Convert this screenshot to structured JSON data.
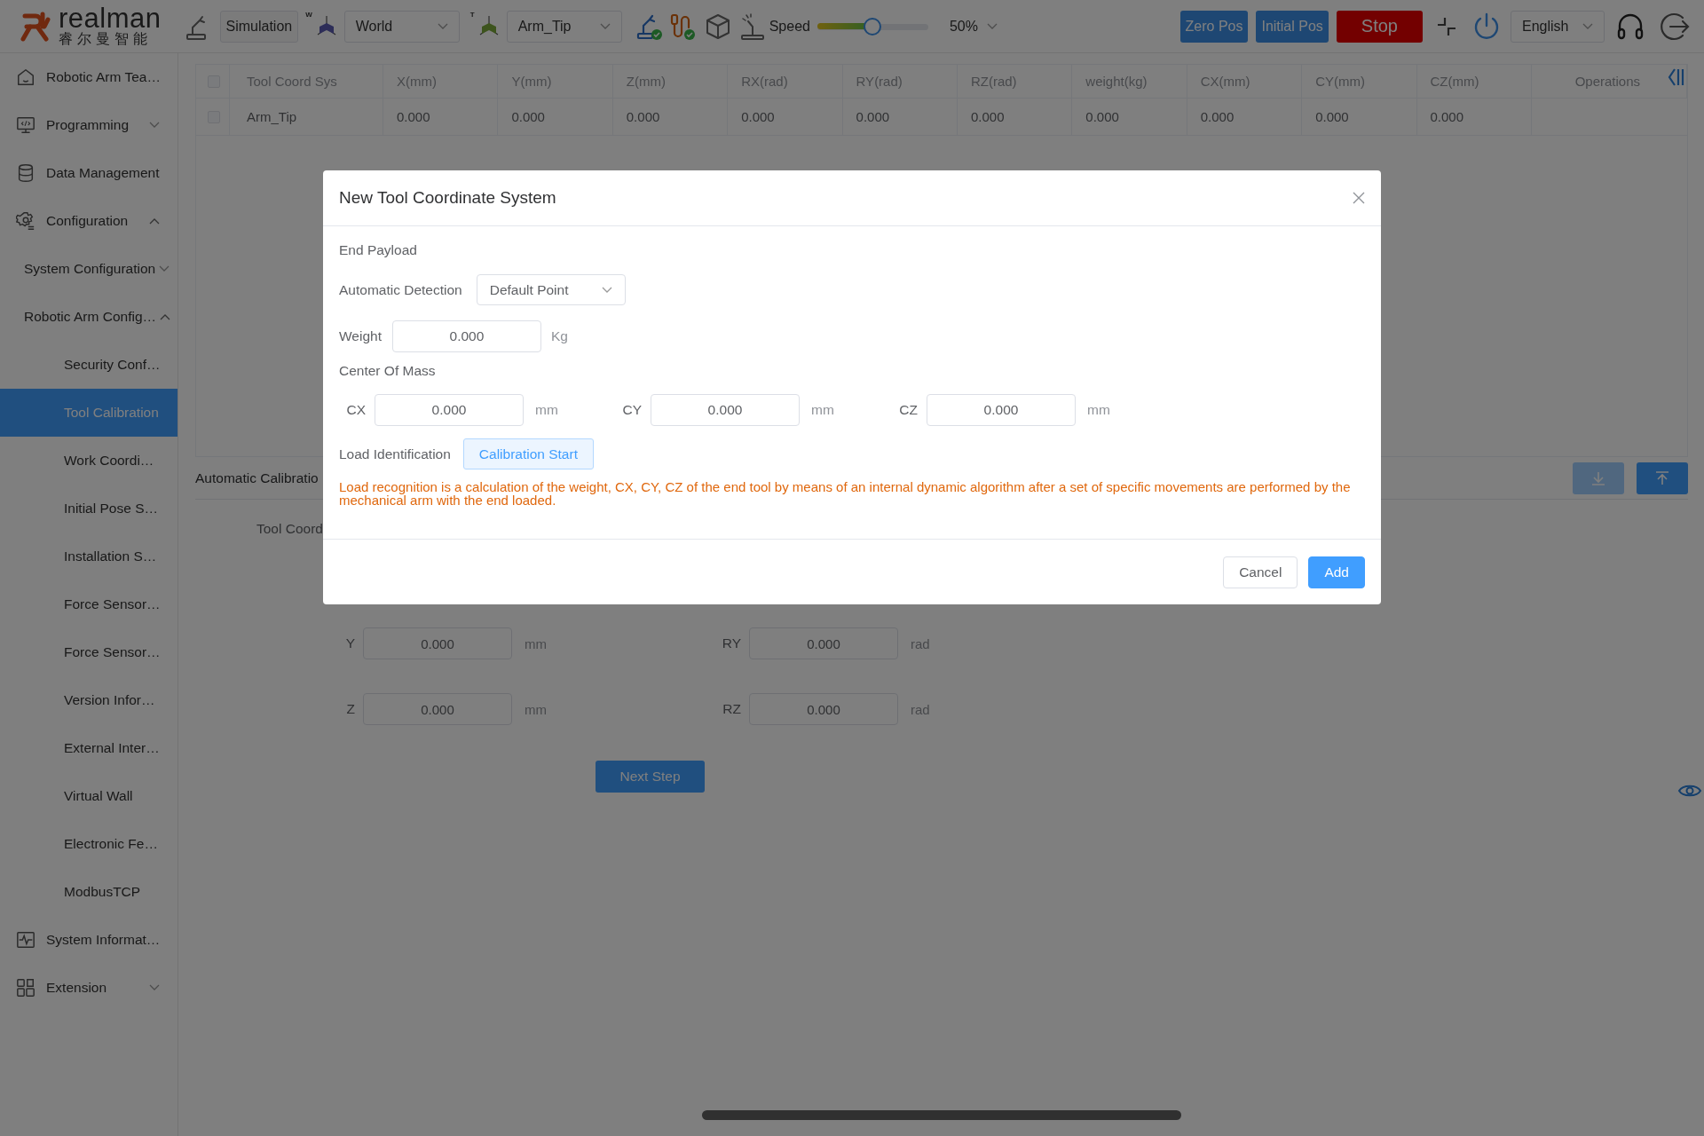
{
  "top_bar": {
    "logo": {
      "brand": "realman",
      "subtitle": "睿尔曼智能"
    },
    "mode_button": "Simulation",
    "coord_axis_letter": "W",
    "coord_select": "World",
    "tool_axis_letter": "T",
    "tool_select": "Arm_Tip",
    "speed": {
      "label": "Speed",
      "level": 0.5,
      "reading": "50%"
    },
    "buttons": [
      {
        "label": "Zero Pos",
        "kind": "primary"
      },
      {
        "label": "Initial Pos",
        "kind": "primary"
      },
      {
        "label": "Stop",
        "kind": "danger"
      }
    ],
    "language": "English"
  },
  "sidebar": {
    "items": [
      {
        "label": "Robotic Arm Tea…",
        "selected": false
      },
      {
        "label": "Programming",
        "selected": false,
        "expanded": false
      },
      {
        "label": "Data Management",
        "selected": false
      },
      {
        "label": "Configuration",
        "selected": false,
        "expanded": true,
        "children": [
          {
            "label": "System Configuration",
            "selected": false,
            "expanded": false
          },
          {
            "label": "Robotic Arm Config…",
            "selected": false,
            "expanded": true,
            "children": [
              {
                "label": "Security Conf…",
                "selected": false
              },
              {
                "label": "Tool Calibration",
                "selected": true
              },
              {
                "label": "Work Coordi…",
                "selected": false
              },
              {
                "label": "Initial Pose S…",
                "selected": false
              },
              {
                "label": "Installation S…",
                "selected": false
              },
              {
                "label": "Force Sensor…",
                "selected": false
              },
              {
                "label": "Force Sensor…",
                "selected": false
              },
              {
                "label": "Version Infor…",
                "selected": false
              },
              {
                "label": "External Inter…",
                "selected": false
              },
              {
                "label": "Virtual Wall",
                "selected": false
              },
              {
                "label": "Electronic Fe…",
                "selected": false
              },
              {
                "label": "ModbusTCP",
                "selected": false
              }
            ]
          }
        ]
      },
      {
        "label": "System Informat…",
        "selected": false
      },
      {
        "label": "Extension",
        "selected": false,
        "expanded": false
      }
    ]
  },
  "table": {
    "select_all": false,
    "columns": [
      "Tool Coord Sys",
      "X(mm)",
      "Y(mm)",
      "Z(mm)",
      "RX(rad)",
      "RY(rad)",
      "RZ(rad)",
      "weight(kg)",
      "CX(mm)",
      "CY(mm)",
      "CZ(mm)",
      "Operations"
    ],
    "rows": [
      {
        "selected": false,
        "cells": [
          "Arm_Tip",
          "0.000",
          "0.000",
          "0.000",
          "0.000",
          "0.000",
          "0.000",
          "0.000",
          "0.000",
          "0.000",
          "0.000"
        ]
      }
    ]
  },
  "calibration": {
    "tab": "Automatic Calibratio",
    "actions": [
      {
        "kind": "download",
        "disabled": true
      },
      {
        "kind": "upload",
        "disabled": false
      }
    ],
    "tool_coord_label": "Tool Coord",
    "rows": [
      [
        {
          "label": "Y",
          "value": "0.000",
          "unit": "mm"
        },
        {
          "label": "RY",
          "value": "0.000",
          "unit": "rad"
        }
      ],
      [
        {
          "label": "Z",
          "value": "0.000",
          "unit": "mm"
        },
        {
          "label": "RZ",
          "value": "0.000",
          "unit": "rad"
        }
      ]
    ],
    "next_button": "Next Step"
  },
  "dialog": {
    "title": "New Tool Coordinate System",
    "section": "End Payload",
    "detection": {
      "label": "Automatic Detection",
      "value": "Default Point"
    },
    "weight": {
      "label": "Weight",
      "value": "0.000",
      "unit": "Kg"
    },
    "center_of_mass": {
      "label": "Center Of Mass",
      "fields": [
        {
          "label": "CX",
          "value": "0.000",
          "unit": "mm"
        },
        {
          "label": "CY",
          "value": "0.000",
          "unit": "mm"
        },
        {
          "label": "CZ",
          "value": "0.000",
          "unit": "mm"
        }
      ]
    },
    "load_identification": {
      "label": "Load Identification",
      "button": "Calibration Start"
    },
    "note": "Load recognition is a calculation of the weight, CX, CY, CZ of the end tool by means of an internal dynamic algorithm after a set of specific movements are performed by the mechanical arm with the end loaded.",
    "buttons": [
      {
        "label": "Cancel",
        "kind": "default"
      },
      {
        "label": "Add",
        "kind": "primary"
      }
    ]
  }
}
